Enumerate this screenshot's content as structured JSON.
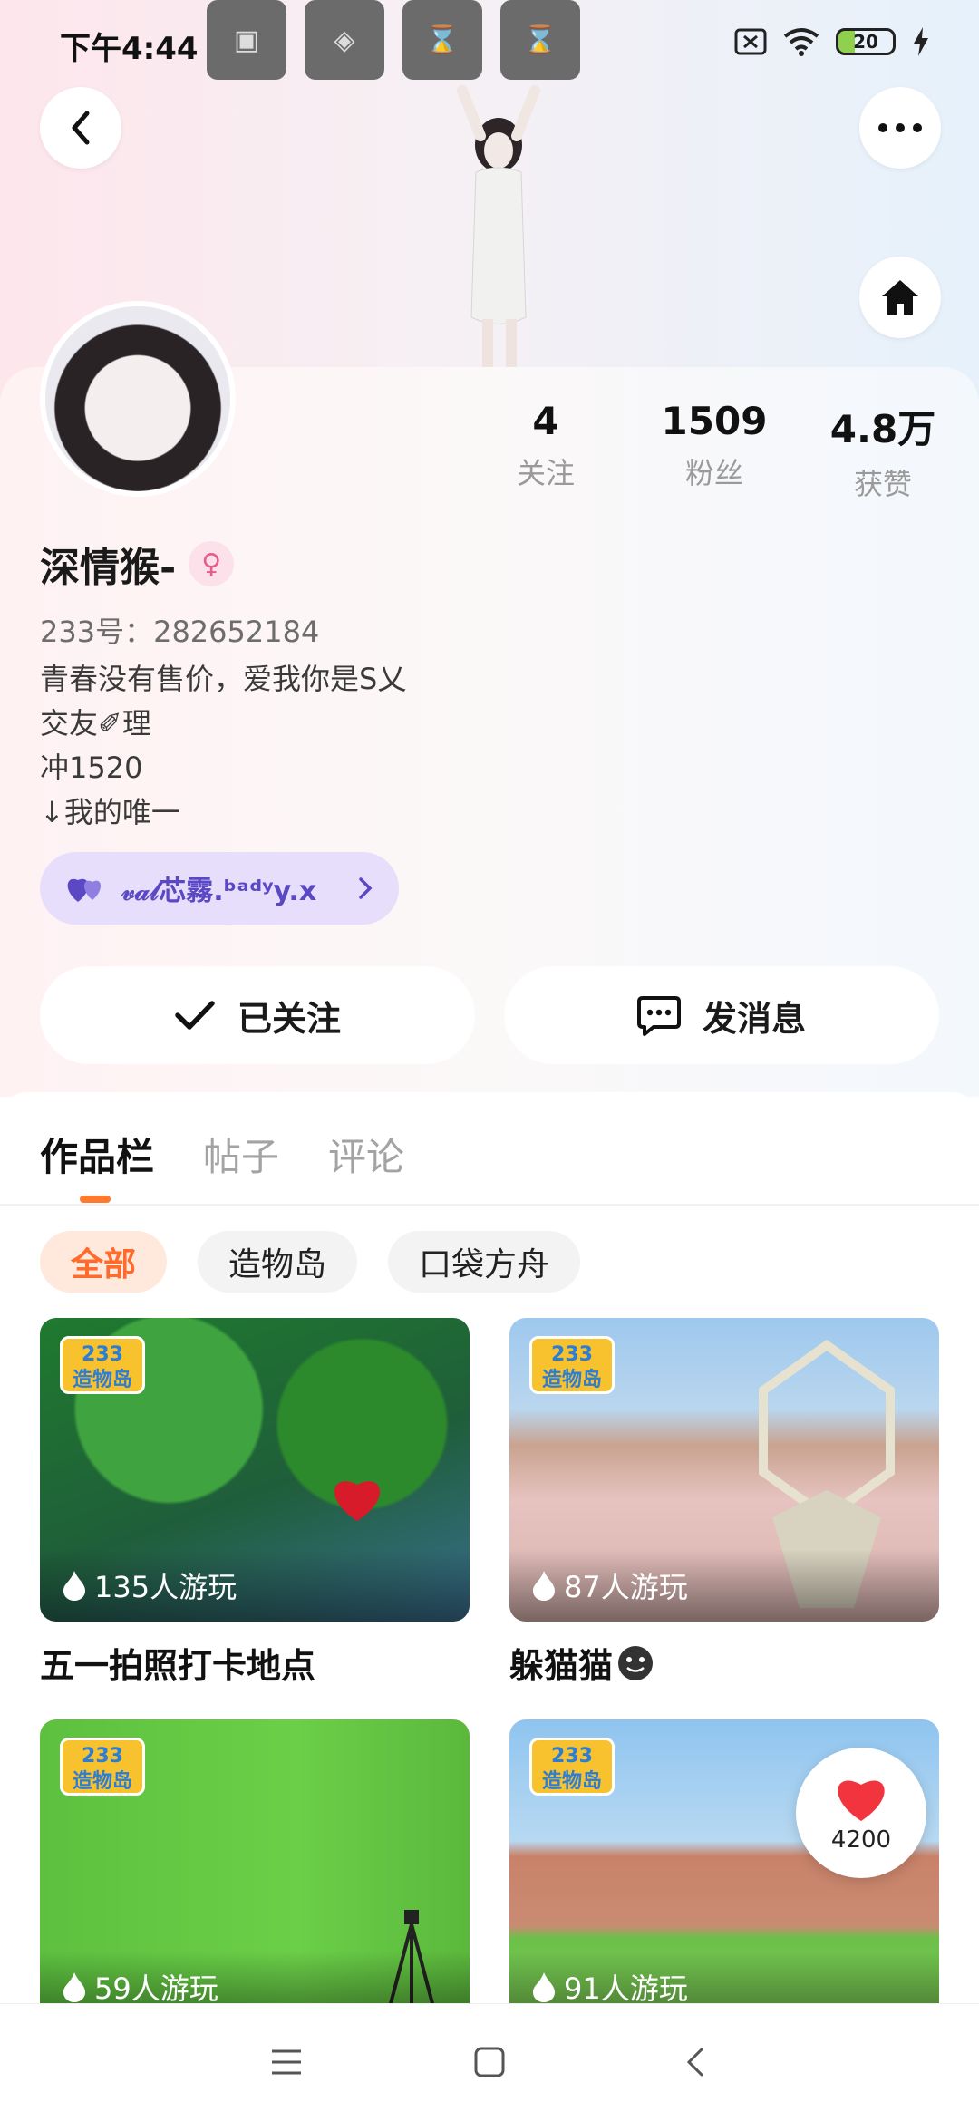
{
  "status_bar": {
    "time": "下午4:44",
    "battery": "20"
  },
  "profile": {
    "stats": [
      {
        "value": "4",
        "label": "关注"
      },
      {
        "value": "1509",
        "label": "粉丝"
      },
      {
        "value": "4.8万",
        "label": "获赞"
      }
    ],
    "name": "深情猴-",
    "gender_symbol": "♀",
    "id_text": "233号：282652184",
    "bio_lines": [
      "青春没有售价，爱我你是S乂",
      "交友✐理",
      "冲1520",
      "↓我的唯一"
    ],
    "tag_text": "𝓋𝒶𝓁芯霧.ᵇᵃᵈʸy.x",
    "follow_button": "已关注",
    "message_button": "发消息"
  },
  "tabs": [
    {
      "label": "作品栏",
      "active": true
    },
    {
      "label": "帖子",
      "active": false
    },
    {
      "label": "评论",
      "active": false
    }
  ],
  "filters": [
    {
      "label": "全部",
      "active": true
    },
    {
      "label": "造物岛",
      "active": false
    },
    {
      "label": "口袋方舟",
      "active": false
    }
  ],
  "works": [
    {
      "plays": "135人游玩",
      "title": "五一拍照打卡地点",
      "badge": "233\n造物岛"
    },
    {
      "plays": "87人游玩",
      "title": "躲猫猫",
      "badge": "233\n造物岛"
    },
    {
      "plays": "59人游玩",
      "title": "",
      "badge": "233\n造物岛"
    },
    {
      "plays": "91人游玩",
      "title": "",
      "badge": "233\n造物岛"
    }
  ],
  "like_float": {
    "count": "4200"
  },
  "colors": {
    "accent": "#ff7a2f",
    "tag_bg": "#e6defa",
    "tag_text": "#5b48c4"
  }
}
